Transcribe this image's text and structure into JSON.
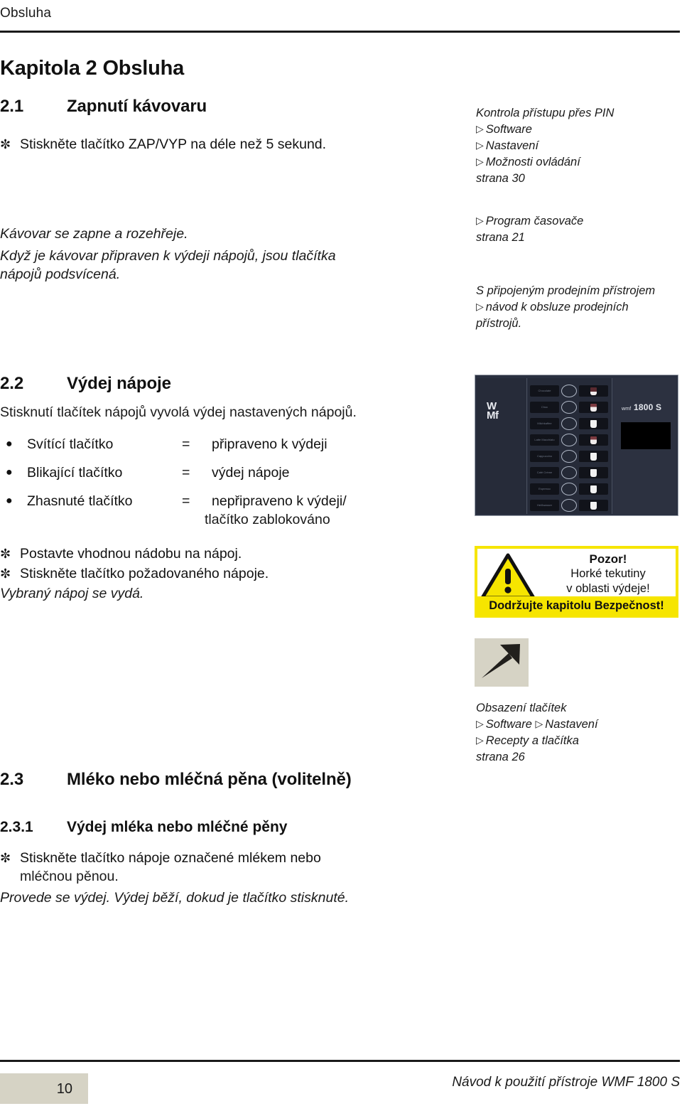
{
  "header": {
    "running_head": "Obsluha"
  },
  "chapter": {
    "title": "Kapitola 2 Obsluha"
  },
  "sections": {
    "s21": {
      "number": "2.1",
      "title": "Zapnutí kávovaru",
      "step_mark": "✼",
      "step_text": "Stiskněte tlačítko ZAP/VYP na déle než 5 sekund.",
      "note_line1": "Kávovar se zapne a rozehřeje.",
      "note_line2": "Když je kávovar připraven k výdeji nápojů, jsou tlačítka",
      "note_line3": "nápojů podsvícená."
    },
    "s22": {
      "number": "2.2",
      "title": "Výdej nápoje",
      "intro": "Stisknutí tlačítek nápojů vyvolá výdej nastavených nápojů.",
      "bullet_char": "●",
      "rows": [
        {
          "label": "Svítící tlačítko",
          "eq": "=",
          "value": "připraveno k výdeji",
          "value2": ""
        },
        {
          "label": "Blikající tlačítko",
          "eq": "=",
          "value": "výdej nápoje",
          "value2": ""
        },
        {
          "label": "Zhasnuté tlačítko",
          "eq": "=",
          "value": "nepřipraveno k výdeji/",
          "value2": "tlačítko zablokováno"
        }
      ],
      "step_mark": "✼",
      "step1": "Postavte vhodnou nádobu na nápoj.",
      "step2": "Stiskněte tlačítko požadovaného nápoje.",
      "result": "Vybraný nápoj se vydá."
    },
    "s23": {
      "number": "2.3",
      "title": "Mléko nebo mléčná pěna (volitelně)"
    },
    "s231": {
      "number": "2.3.1",
      "title": "Výdej mléka nebo mléčné pěny",
      "step_mark": "✼",
      "step_line1": "Stiskněte tlačítko nápoje označené mlékem nebo",
      "step_line2": "mléčnou pěnou.",
      "result": "Provede se výdej. Výdej běží, dokud je tlačítko stisknuté."
    }
  },
  "margin_notes": {
    "note1": {
      "line1": "Kontrola přístupu přes PIN",
      "line2": "Software",
      "line3": "Nastavení",
      "line4": "Možnosti ovládání",
      "line5": "strana 30",
      "triangle": "▷"
    },
    "note2": {
      "line1": "Program časovače",
      "line2": "strana 21",
      "triangle": "▷"
    },
    "note3": {
      "line1": "S připojeným prodejním přístrojem",
      "line2": "návod k obsluze prodejních",
      "line3": "přístrojů.",
      "triangle": "▷"
    },
    "note4": {
      "line1": "Obsazení tlačítek",
      "line2a": "Software",
      "line2b": "Nastavení",
      "line3": "Recepty a tlačítka",
      "line4": "strana 26",
      "triangle": "▷"
    }
  },
  "machine": {
    "brand_logo": "W\nMf",
    "model_prefix": "wmf",
    "model_name": "1800 S",
    "buttons": [
      {
        "label": "Chocolate",
        "cup": "dark"
      },
      {
        "label": "Choc",
        "cup": "half"
      },
      {
        "label": "Milchkaffee",
        "cup": "light"
      },
      {
        "label": "Latte Macchiato",
        "cup": "half"
      },
      {
        "label": "Cappuccino",
        "cup": "light"
      },
      {
        "label": "Café Crème",
        "cup": "light"
      },
      {
        "label": "Espresso",
        "cup": "light"
      },
      {
        "label": "Heißwasser",
        "cup": "light"
      }
    ]
  },
  "warning": {
    "title": "Pozor!",
    "line1": "Horké tekutiny",
    "line2": "v oblasti výdeje!",
    "bar": "Dodržujte kapitolu Bezpečnost!",
    "icon_color": "#f6e500"
  },
  "footer": {
    "page_number": "10",
    "right_text": "Návod k použití přístroje WMF 1800 S"
  },
  "colors": {
    "beige": "#d6d3c5",
    "warning_yellow": "#f6e500",
    "machine_dark": "#2a3040",
    "rule": "#1a1a1a"
  }
}
